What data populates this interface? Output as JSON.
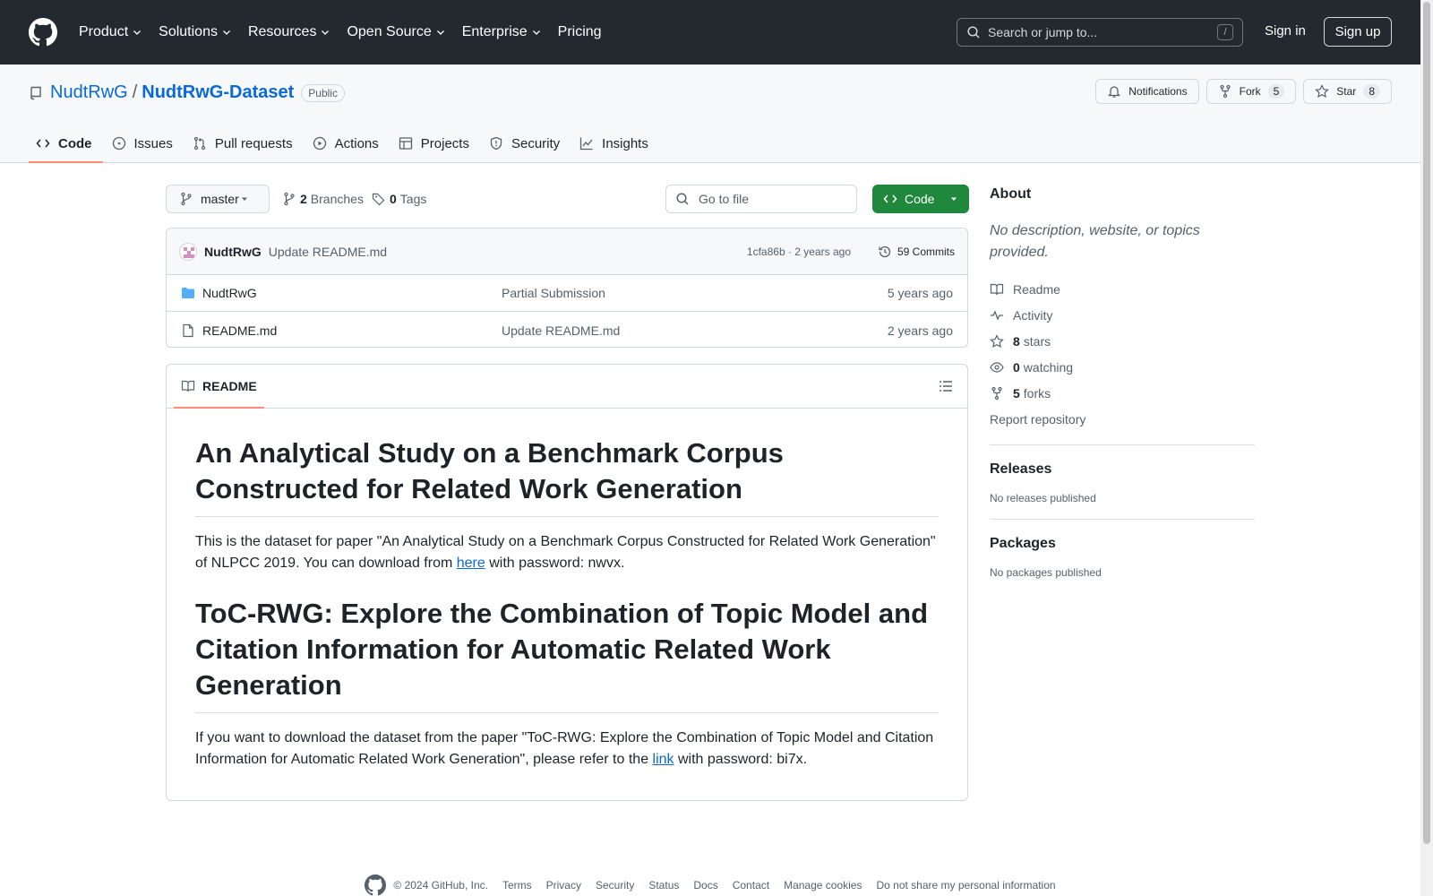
{
  "header": {
    "nav": [
      "Product",
      "Solutions",
      "Resources",
      "Open Source",
      "Enterprise",
      "Pricing"
    ],
    "search_placeholder": "Search or jump to...",
    "search_shortcut": "/",
    "sign_in": "Sign in",
    "sign_up": "Sign up"
  },
  "repo": {
    "owner": "NudtRwG",
    "separator": "/",
    "name": "NudtRwG-Dataset",
    "visibility": "Public",
    "notifications": "Notifications",
    "fork_label": "Fork",
    "fork_count": "5",
    "star_label": "Star",
    "star_count": "8"
  },
  "tabs": [
    "Code",
    "Issues",
    "Pull requests",
    "Actions",
    "Projects",
    "Security",
    "Insights"
  ],
  "toolbar": {
    "branch": "master",
    "branches_count": "2",
    "branches_label": "Branches",
    "tags_count": "0",
    "tags_label": "Tags",
    "goto_placeholder": "Go to file",
    "code_button": "Code"
  },
  "commit": {
    "author": "NudtRwG",
    "message": "Update README.md",
    "meta": "1cfa86b · 2 years ago",
    "commits": "59 Commits"
  },
  "files": [
    {
      "name": "NudtRwG",
      "type": "folder",
      "message": "Partial Submission",
      "age": "5 years ago"
    },
    {
      "name": "README.md",
      "type": "file",
      "message": "Update README.md",
      "age": "2 years ago"
    }
  ],
  "readme": {
    "tab_label": "README",
    "h1_a": "An Analytical Study on a Benchmark Corpus Constructed for Related Work Generation",
    "p1_before": "This is the dataset for paper \"An Analytical Study on a Benchmark Corpus Constructed for Related Work Generation\" of NLPCC 2019. You can download from ",
    "p1_link": "here",
    "p1_after": " with password: nwvx.",
    "h1_b": "ToC-RWG: Explore the Combination of Topic Model and Citation Information for Automatic Related Work Generation",
    "p2_before": "If you want to download the dataset from the paper \"ToC-RWG: Explore the Combination of Topic Model and Citation Information for Automatic Related Work Generation\", please refer to the ",
    "p2_link": "link",
    "p2_after": " with password: bi7x."
  },
  "about": {
    "title": "About",
    "description": "No description, website, or topics provided.",
    "readme": "Readme",
    "activity": "Activity",
    "stars_count": "8",
    "stars_label": "stars",
    "watching_count": "0",
    "watching_label": "watching",
    "forks_count": "5",
    "forks_label": "forks",
    "report": "Report repository"
  },
  "releases": {
    "title": "Releases",
    "empty": "No releases published"
  },
  "packages": {
    "title": "Packages",
    "empty": "No packages published"
  },
  "footer": {
    "copyright": "© 2024 GitHub, Inc.",
    "links": [
      "Terms",
      "Privacy",
      "Security",
      "Status",
      "Docs",
      "Contact",
      "Manage cookies",
      "Do not share my personal information"
    ]
  },
  "colors": {
    "header_bg": "#24292f",
    "link": "#0969da",
    "primary_button": "#1f883d",
    "active_tab_underline": "#fd8c73",
    "folder_icon": "#54aeff"
  }
}
